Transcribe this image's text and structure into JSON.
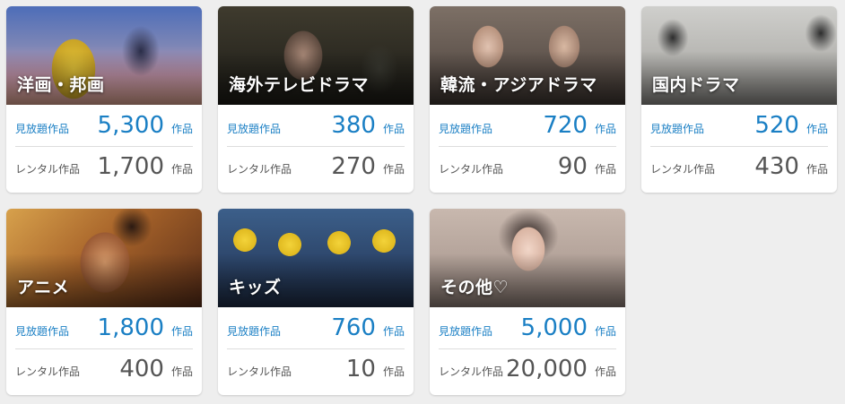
{
  "cards": [
    {
      "title": "洋画・邦画",
      "image": "movie-dance-scene",
      "unlimited_label": "見放題作品",
      "unlimited_count": "5,300",
      "unlimited_unit": "作品",
      "rental_label": "レンタル作品",
      "rental_count": "1,700",
      "rental_unit": "作品"
    },
    {
      "title": "海外テレビドラマ",
      "image": "drama-man-portrait",
      "unlimited_label": "見放題作品",
      "unlimited_count": "380",
      "unlimited_unit": "作品",
      "rental_label": "レンタル作品",
      "rental_count": "270",
      "rental_unit": "作品"
    },
    {
      "title": "韓流・アジアドラマ",
      "image": "asian-drama-couple",
      "unlimited_label": "見放題作品",
      "unlimited_count": "720",
      "unlimited_unit": "作品",
      "rental_label": "レンタル作品",
      "rental_count": "90",
      "rental_unit": "作品"
    },
    {
      "title": "国内ドラマ",
      "image": "domestic-drama-scene",
      "unlimited_label": "見放題作品",
      "unlimited_count": "520",
      "unlimited_unit": "作品",
      "rental_label": "レンタル作品",
      "rental_count": "430",
      "rental_unit": "作品"
    },
    {
      "title": "アニメ",
      "image": "anime-character",
      "unlimited_label": "見放題作品",
      "unlimited_count": "1,800",
      "unlimited_unit": "作品",
      "rental_label": "レンタル作品",
      "rental_count": "400",
      "rental_unit": "作品"
    },
    {
      "title": "キッズ",
      "image": "kids-minions",
      "unlimited_label": "見放題作品",
      "unlimited_count": "760",
      "unlimited_unit": "作品",
      "rental_label": "レンタル作品",
      "rental_count": "10",
      "rental_unit": "作品"
    },
    {
      "title": "その他♡",
      "image": "other-portrait",
      "unlimited_label": "見放題作品",
      "unlimited_count": "5,000",
      "unlimited_unit": "作品",
      "rental_label": "レンタル作品",
      "rental_count": "20,000",
      "rental_unit": "作品"
    }
  ],
  "colors": {
    "unlimited": "#1a7fc4",
    "rental": "#555555",
    "page_background": "#eeeeee"
  }
}
